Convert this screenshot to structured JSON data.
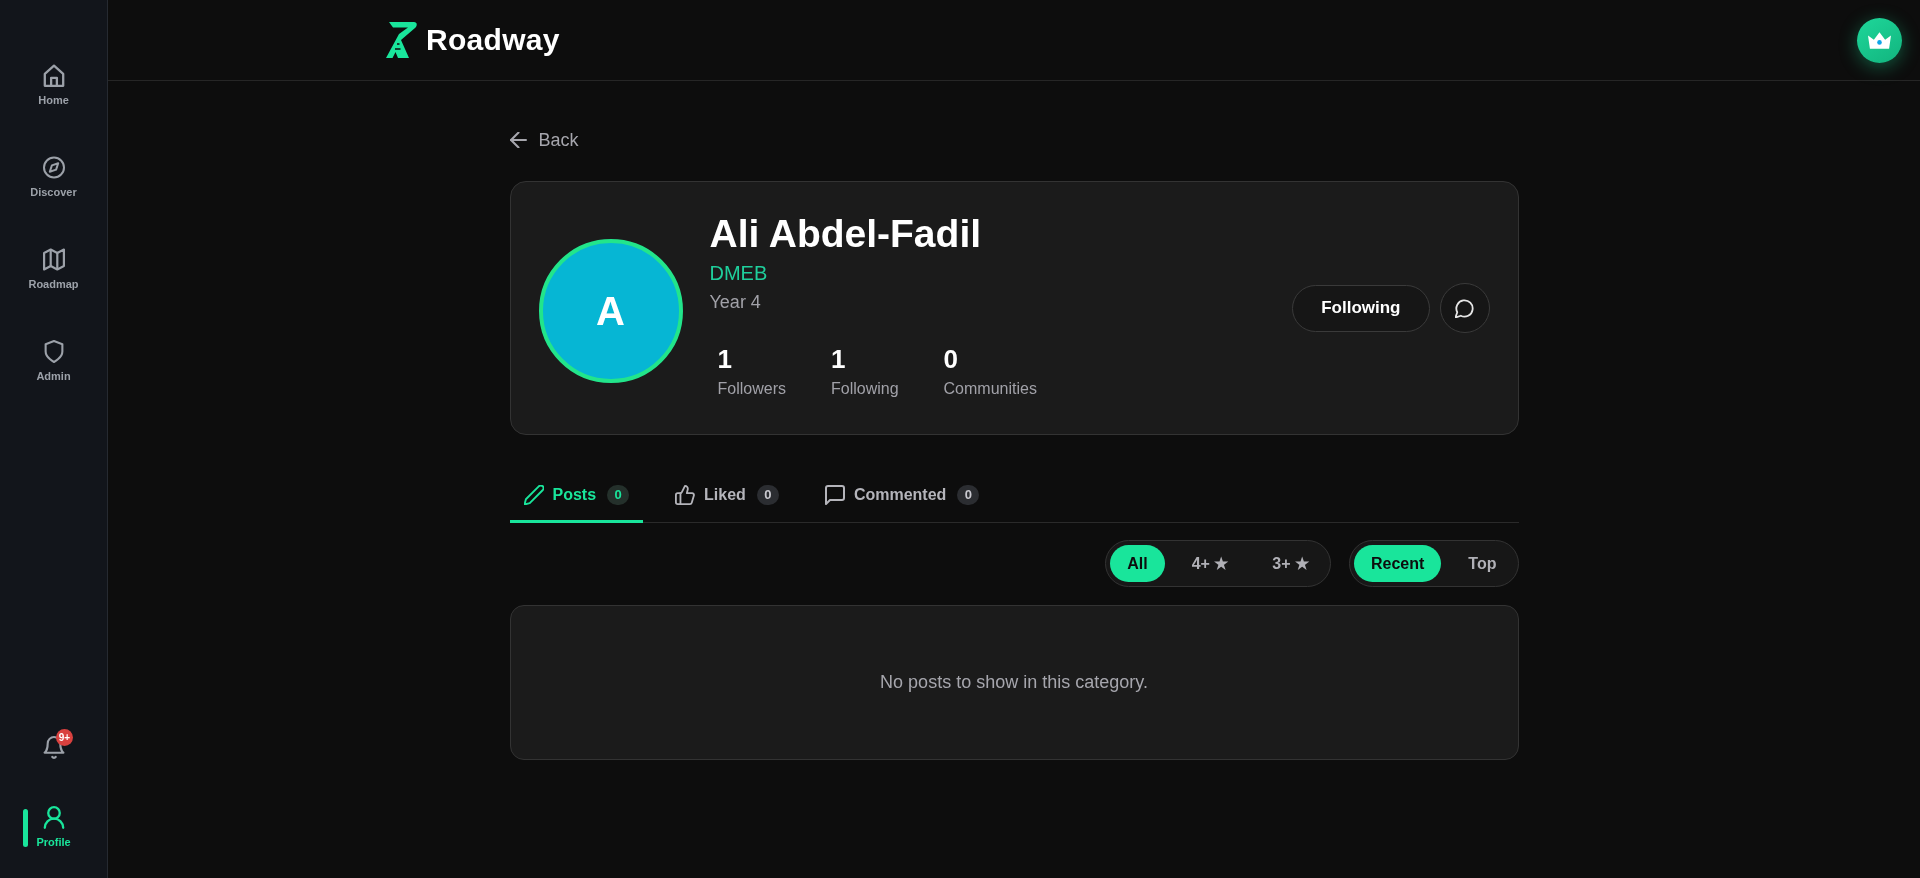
{
  "sidebar": {
    "items": [
      {
        "kind": "home",
        "label": "Home",
        "selected": false
      },
      {
        "kind": "discover",
        "label": "Discover",
        "selected": false
      },
      {
        "kind": "roadmap",
        "label": "Roadmap",
        "selected": false
      },
      {
        "kind": "admin",
        "label": "Admin",
        "selected": false
      }
    ],
    "notifications": {
      "badge": "9+"
    },
    "profile": {
      "label": "Profile",
      "selected": true
    }
  },
  "header": {
    "brand": "Roadway"
  },
  "back": {
    "label": "Back"
  },
  "profile": {
    "avatar_letter": "A",
    "name": "Ali Abdel-Fadil",
    "department": "DMEB",
    "year": "Year 4",
    "stats": [
      {
        "value": "1",
        "label": "Followers"
      },
      {
        "value": "1",
        "label": "Following"
      },
      {
        "value": "0",
        "label": "Communities"
      }
    ],
    "follow_button": {
      "label": "Following"
    }
  },
  "tabs": [
    {
      "kind": "posts",
      "label": "Posts",
      "count": "0",
      "selected": true
    },
    {
      "kind": "liked",
      "label": "Liked",
      "count": "0",
      "selected": false
    },
    {
      "kind": "commented",
      "label": "Commented",
      "count": "0",
      "selected": false
    }
  ],
  "rating_filters": [
    {
      "label": "All",
      "selected": true
    },
    {
      "label": "4+ ★",
      "selected": false
    },
    {
      "label": "3+ ★",
      "selected": false
    }
  ],
  "sort_filters": [
    {
      "label": "Recent",
      "selected": true
    },
    {
      "label": "Top",
      "selected": false
    }
  ],
  "empty_state": {
    "message": "No posts to show in this category."
  }
}
